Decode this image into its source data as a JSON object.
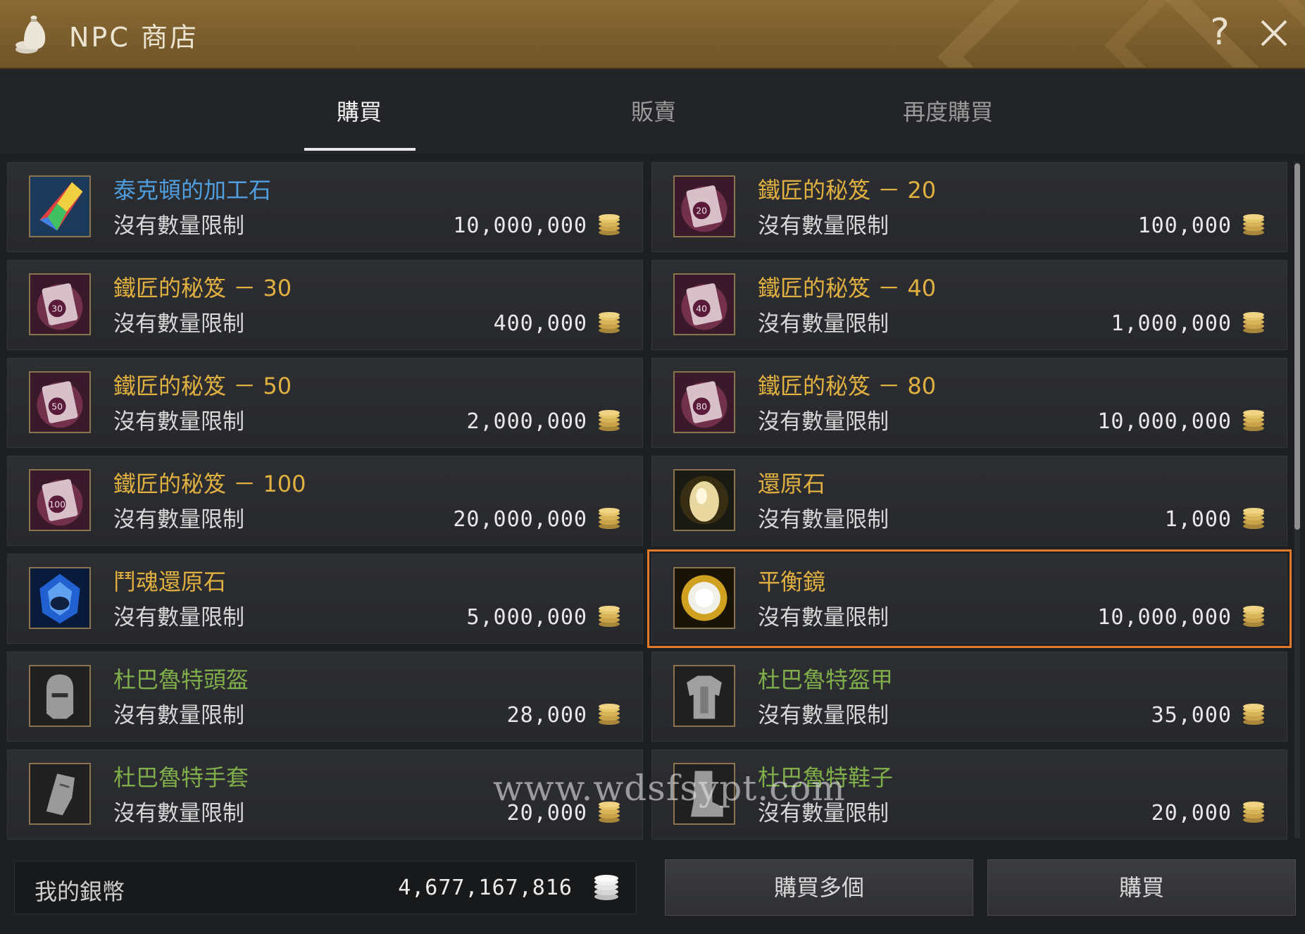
{
  "window": {
    "title": "NPC 商店"
  },
  "header": {
    "help_glyph": "?"
  },
  "tabs": [
    {
      "label": "購買",
      "active": true
    },
    {
      "label": "販賣",
      "active": false
    },
    {
      "label": "再度購買",
      "active": false
    }
  ],
  "items": [
    {
      "name": "泰克頓的加工石",
      "limit": "沒有數量限制",
      "price": "10,000,000",
      "name_color": "#4f9fe0",
      "icon": "crystal-stone-icon"
    },
    {
      "name": "鐵匠的秘笈 － 20",
      "limit": "沒有數量限制",
      "price": "100,000",
      "name_color": "#e0b040",
      "icon": "blacksmith-book-icon",
      "badge": "20"
    },
    {
      "name": "鐵匠的秘笈 － 30",
      "limit": "沒有數量限制",
      "price": "400,000",
      "name_color": "#e0b040",
      "icon": "blacksmith-book-icon",
      "badge": "30"
    },
    {
      "name": "鐵匠的秘笈 － 40",
      "limit": "沒有數量限制",
      "price": "1,000,000",
      "name_color": "#e0b040",
      "icon": "blacksmith-book-icon",
      "badge": "40"
    },
    {
      "name": "鐵匠的秘笈 － 50",
      "limit": "沒有數量限制",
      "price": "2,000,000",
      "name_color": "#e0b040",
      "icon": "blacksmith-book-icon",
      "badge": "50"
    },
    {
      "name": "鐵匠的秘笈 － 80",
      "limit": "沒有數量限制",
      "price": "10,000,000",
      "name_color": "#e0b040",
      "icon": "blacksmith-book-icon",
      "badge": "80"
    },
    {
      "name": "鐵匠的秘笈 － 100",
      "limit": "沒有數量限制",
      "price": "20,000,000",
      "name_color": "#e0b040",
      "icon": "blacksmith-book-icon",
      "badge": "100"
    },
    {
      "name": "還原石",
      "limit": "沒有數量限制",
      "price": "1,000",
      "name_color": "#e0b040",
      "icon": "restoration-stone-icon"
    },
    {
      "name": "鬥魂還原石",
      "limit": "沒有數量限制",
      "price": "5,000,000",
      "name_color": "#e0b040",
      "icon": "spirit-restoration-stone-icon"
    },
    {
      "name": "平衡鏡",
      "limit": "沒有數量限制",
      "price": "10,000,000",
      "name_color": "#e0b040",
      "icon": "balance-mirror-icon",
      "selected": true
    },
    {
      "name": "杜巴魯特頭盔",
      "limit": "沒有數量限制",
      "price": "28,000",
      "name_color": "#7fae4a",
      "icon": "helmet-icon"
    },
    {
      "name": "杜巴魯特盔甲",
      "limit": "沒有數量限制",
      "price": "35,000",
      "name_color": "#7fae4a",
      "icon": "armor-icon"
    },
    {
      "name": "杜巴魯特手套",
      "limit": "沒有數量限制",
      "price": "20,000",
      "name_color": "#7fae4a",
      "icon": "gloves-icon"
    },
    {
      "name": "杜巴魯特鞋子",
      "limit": "沒有數量限制",
      "price": "20,000",
      "name_color": "#7fae4a",
      "icon": "boots-icon"
    }
  ],
  "watermark": "www.wdsfsypt.com",
  "footer": {
    "silver_label": "我的銀幣",
    "silver_value": "4,677,167,816",
    "buy_multiple_label": "購買多個",
    "buy_label": "購買"
  }
}
